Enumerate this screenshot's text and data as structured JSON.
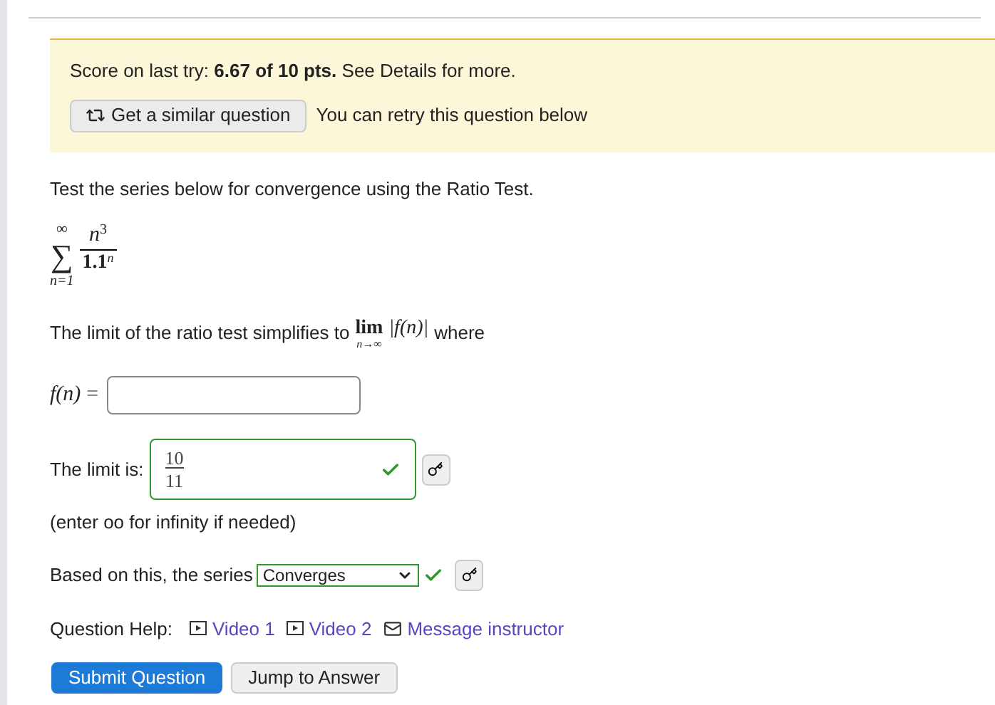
{
  "score_notice": {
    "label": "Score on last try:",
    "score": "6.67 of 10 pts.",
    "suffix": "See Details for more.",
    "similar_button": "Get a similar question",
    "retry_note": "You can retry this question below"
  },
  "question": {
    "prompt": "Test the series below for convergence using the Ratio Test.",
    "series": {
      "symbol": "∑",
      "upper": "∞",
      "lower": "n=1",
      "numerator": "n",
      "numerator_exp": "3",
      "denominator": "1.1",
      "denominator_exp": "n"
    },
    "limit_sentence": {
      "before": "The limit of the ratio test simplifies to",
      "lim": "lim",
      "lim_sub": "n→∞",
      "expression": "|f(n)|",
      "after": "where"
    },
    "f_field": {
      "label": "f(n)",
      "equals": "="
    },
    "limit_field": {
      "label": "The limit is:",
      "numerator": "10",
      "denominator": "11",
      "correct": true
    },
    "hint": "(enter oo for infinity if needed)",
    "series_select": {
      "label": "Based on this, the series",
      "value": "Converges",
      "correct": true
    }
  },
  "help": {
    "label": "Question Help:",
    "links": [
      {
        "kind": "video",
        "label": "Video 1"
      },
      {
        "kind": "video",
        "label": "Video 2"
      },
      {
        "kind": "message",
        "label": "Message instructor"
      }
    ]
  },
  "buttons": [
    {
      "kind": "primary",
      "label": "Submit Question"
    },
    {
      "kind": "secondary",
      "label": "Jump to Answer"
    }
  ]
}
